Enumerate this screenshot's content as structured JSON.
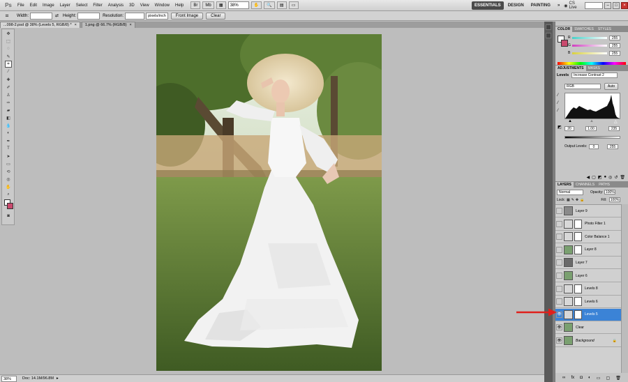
{
  "app": {
    "logo": "Ps"
  },
  "menu": [
    "File",
    "Edit",
    "Image",
    "Layer",
    "Select",
    "Filter",
    "Analysis",
    "3D",
    "View",
    "Window",
    "Help"
  ],
  "zoom": "38%",
  "workspace": {
    "essentials": "ESSENTIALS",
    "design": "DESIGN",
    "painting": "PAINTING",
    "more": "»",
    "cslive": "CS Live"
  },
  "options": {
    "width_label": "Width:",
    "height_label": "Height:",
    "resolution_label": "Resolution:",
    "unit": "pixels/inch",
    "front_image": "Front Image",
    "clear": "Clear"
  },
  "tabs": [
    {
      "label": "...098-2.psd @ 38% (Levels 5, RGB/8) *",
      "close": "×"
    },
    {
      "label": "1.png @ 66.7% (RGB/8)",
      "close": "×"
    }
  ],
  "status": {
    "zoom": "38%",
    "doc": "Doc: 14.1M/96.8M"
  },
  "color_panel": {
    "tabs": [
      "COLOR",
      "SWATCHES",
      "STYLES"
    ],
    "channels": [
      {
        "label": "R",
        "value": "255",
        "color": "#48d0c8"
      },
      {
        "label": "G",
        "value": "255",
        "color": "#d040c0"
      },
      {
        "label": "B",
        "value": "255",
        "color": "#d8d040"
      }
    ]
  },
  "adjustments_panel": {
    "tabs": [
      "ADJUSTMENTS",
      "MASKS"
    ],
    "title": "Levels",
    "preset": "Increase Contrast 2",
    "channel": "RGB",
    "auto": "Auto",
    "input_levels": [
      "20",
      "1.00",
      "235"
    ],
    "output_label": "Output Levels:",
    "output_levels": [
      "0",
      "255"
    ]
  },
  "layers_panel": {
    "tabs": [
      "LAYERS",
      "CHANNELS",
      "PATHS"
    ],
    "blend_mode": "Normal",
    "opacity_label": "Opacity:",
    "opacity": "100%",
    "lock_label": "Lock:",
    "fill_label": "Fill:",
    "fill": "100%",
    "layers": [
      {
        "name": "Layer 9",
        "visible": false,
        "has_mask": false,
        "selected": false,
        "thumb": "#8a8a8a"
      },
      {
        "name": "Photo Filter 1",
        "visible": false,
        "has_mask": true,
        "selected": false,
        "thumb": "#d8d8d8"
      },
      {
        "name": "Color Balance 1",
        "visible": false,
        "has_mask": true,
        "selected": false,
        "thumb": "#d8d8d8"
      },
      {
        "name": "Layer 8",
        "visible": false,
        "has_mask": true,
        "selected": false,
        "thumb": "#7aa070"
      },
      {
        "name": "Layer 7",
        "visible": false,
        "has_mask": false,
        "selected": false,
        "thumb": "#6a6a6a"
      },
      {
        "name": "Layer 6",
        "visible": false,
        "has_mask": false,
        "selected": false,
        "thumb": "#7aa070"
      },
      {
        "name": "Levels 8",
        "visible": false,
        "has_mask": true,
        "selected": false,
        "thumb": "#d8d8d8"
      },
      {
        "name": "Levels 6",
        "visible": false,
        "has_mask": true,
        "selected": false,
        "thumb": "#d8d8d8"
      },
      {
        "name": "Levels 5",
        "visible": true,
        "has_mask": true,
        "selected": true,
        "thumb": "#d8d8d8"
      },
      {
        "name": "Clear",
        "visible": true,
        "has_mask": false,
        "selected": false,
        "thumb": "#7aa070"
      },
      {
        "name": "Background",
        "visible": true,
        "has_mask": false,
        "selected": false,
        "thumb": "#7aa070",
        "locked": true
      }
    ]
  },
  "accent_colors": {
    "selection": "#3b83d6",
    "arrow": "#e0201c",
    "background_swatch": "#c94a6e"
  }
}
